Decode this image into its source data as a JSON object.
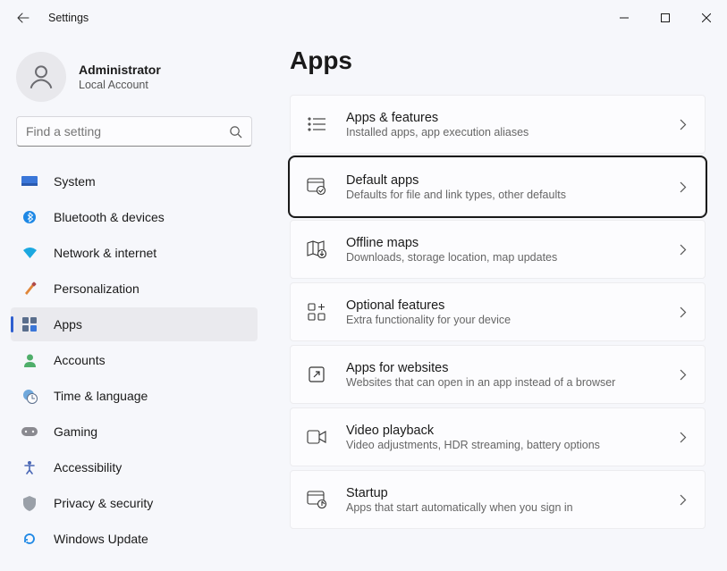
{
  "window": {
    "title": "Settings"
  },
  "profile": {
    "name": "Administrator",
    "account_type": "Local Account"
  },
  "search": {
    "placeholder": "Find a setting"
  },
  "sidebar": {
    "items": [
      {
        "label": "System"
      },
      {
        "label": "Bluetooth & devices"
      },
      {
        "label": "Network & internet"
      },
      {
        "label": "Personalization"
      },
      {
        "label": "Apps"
      },
      {
        "label": "Accounts"
      },
      {
        "label": "Time & language"
      },
      {
        "label": "Gaming"
      },
      {
        "label": "Accessibility"
      },
      {
        "label": "Privacy & security"
      },
      {
        "label": "Windows Update"
      }
    ],
    "selected_index": 4
  },
  "page": {
    "title": "Apps",
    "cards": [
      {
        "title": "Apps & features",
        "subtitle": "Installed apps, app execution aliases"
      },
      {
        "title": "Default apps",
        "subtitle": "Defaults for file and link types, other defaults"
      },
      {
        "title": "Offline maps",
        "subtitle": "Downloads, storage location, map updates"
      },
      {
        "title": "Optional features",
        "subtitle": "Extra functionality for your device"
      },
      {
        "title": "Apps for websites",
        "subtitle": "Websites that can open in an app instead of a browser"
      },
      {
        "title": "Video playback",
        "subtitle": "Video adjustments, HDR streaming, battery options"
      },
      {
        "title": "Startup",
        "subtitle": "Apps that start automatically when you sign in"
      }
    ],
    "focused_index": 1
  }
}
